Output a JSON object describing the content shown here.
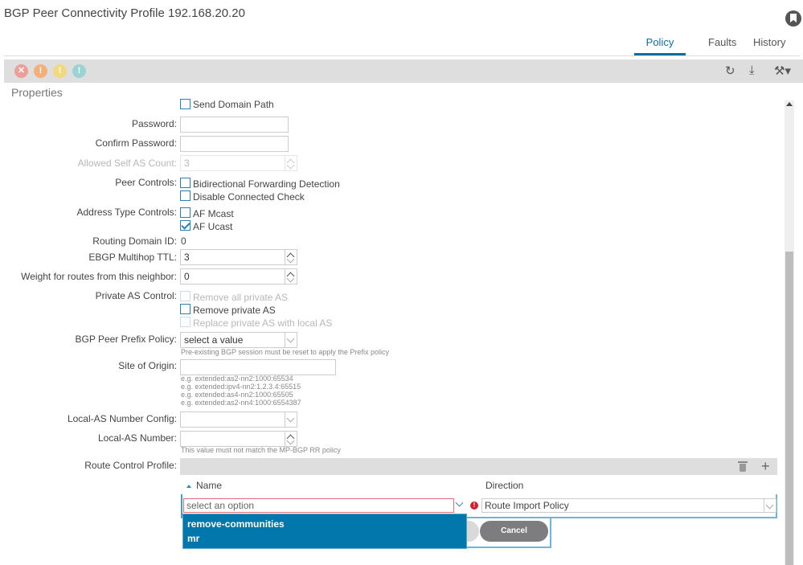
{
  "header": {
    "title": "BGP Peer Connectivity Profile 192.168.20.20",
    "tabs": [
      {
        "label": "Policy",
        "active": true
      },
      {
        "label": "Faults",
        "active": false
      },
      {
        "label": "History",
        "active": false
      }
    ]
  },
  "toolbar": {
    "fault_icons": [
      "critical-fault-icon",
      "major-fault-icon",
      "minor-fault-icon",
      "warning-fault-icon"
    ],
    "fault_glyphs": {
      "critical": "✕",
      "major": "!",
      "minor": "!",
      "warning": "!"
    },
    "refresh_glyph": "↻",
    "download_glyph": "⤓",
    "tools_glyph": "⚒▾"
  },
  "section_title": "Properties",
  "form": {
    "send_domain_path": {
      "label": "Send Domain Path",
      "checked": false
    },
    "password": {
      "label": "Password:",
      "value": ""
    },
    "confirm_password": {
      "label": "Confirm Password:",
      "value": ""
    },
    "allowed_self_as_count": {
      "label": "Allowed Self AS Count:",
      "value": "3",
      "disabled": true
    },
    "peer_controls": {
      "label": "Peer Controls:",
      "options": [
        {
          "label": "Bidirectional Forwarding Detection",
          "checked": false
        },
        {
          "label": "Disable Connected Check",
          "checked": false
        }
      ]
    },
    "address_type_controls": {
      "label": "Address Type Controls:",
      "options": [
        {
          "label": "AF Mcast",
          "checked": false
        },
        {
          "label": "AF Ucast",
          "checked": true
        }
      ]
    },
    "routing_domain_id": {
      "label": "Routing Domain ID:",
      "value": "0"
    },
    "ebgp_multihop_ttl": {
      "label": "EBGP Multihop TTL:",
      "value": "3"
    },
    "weight": {
      "label": "Weight for routes from this neighbor:",
      "value": "0"
    },
    "private_as_control": {
      "label": "Private AS Control:",
      "options": [
        {
          "label": "Remove all private AS",
          "checked": false,
          "disabled": true
        },
        {
          "label": "Remove private AS",
          "checked": false,
          "disabled": false
        },
        {
          "label": "Replace private AS with local AS",
          "checked": false,
          "disabled": true
        }
      ]
    },
    "bgp_peer_prefix_policy": {
      "label": "BGP Peer Prefix Policy:",
      "value": "select a value",
      "hint": "Pre-existing BGP session must be reset to apply the Prefix policy"
    },
    "site_of_origin": {
      "label": "Site of Origin:",
      "value": "",
      "hints": [
        "e.g. extended:as2-nn2:1000:65534",
        "e.g. extended:ipv4-nn2:1.2.3.4:65515",
        "e.g. extended:as4-nn2:1000:65505",
        "e.g. extended:as2-nn4:1000:6554387"
      ]
    },
    "local_as_number_config": {
      "label": "Local-AS Number Config:",
      "value": ""
    },
    "local_as_number": {
      "label": "Local-AS Number:",
      "value": "",
      "hint": "This value must not match the MP-BGP RR policy"
    },
    "route_control_profile": {
      "label": "Route Control Profile:",
      "columns": [
        "Name",
        "Direction"
      ],
      "edit_row": {
        "name_placeholder": "select an option",
        "direction_value": "Route Import Policy",
        "error_glyph": "!"
      },
      "name_options": [
        "remove-communities",
        "mr"
      ],
      "cancel_label": "Cancel",
      "plus_glyph": "+"
    }
  }
}
